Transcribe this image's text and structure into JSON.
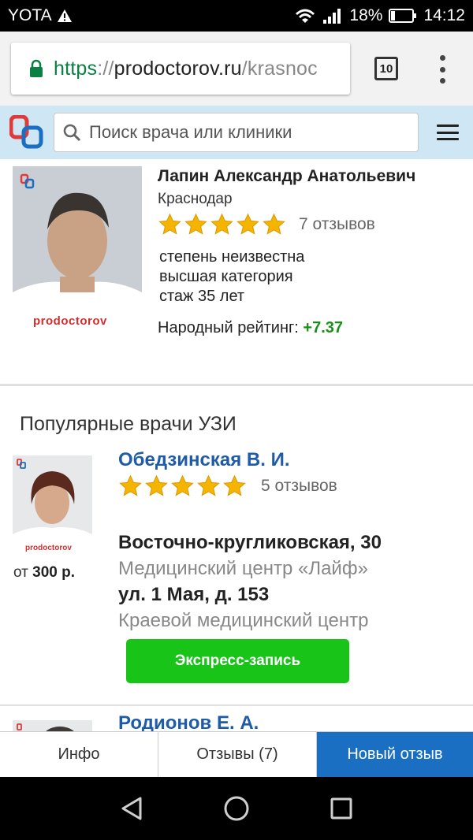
{
  "status_bar": {
    "carrier": "YOTA",
    "battery": "18%",
    "time": "14:12"
  },
  "browser": {
    "url_scheme": "https",
    "url_sep": "://",
    "url_host": "prodoctorov.ru",
    "url_path": "/krasnoc",
    "tab_count": "10"
  },
  "site_header": {
    "search_placeholder": "Поиск врача или клиники"
  },
  "doctor": {
    "name": "Лапин Александр Анатольевич",
    "city": "Краснодар",
    "stars": 5,
    "reviews": "7 отзывов",
    "degree": "степень неизвестна",
    "category": "высшая категория",
    "experience": "стаж 35 лет",
    "people_rating_label": "Народный рейтинг:",
    "people_rating_value": "+7.37",
    "photo_watermark": "prodoctorov"
  },
  "popular": {
    "title": "Популярные врачи УЗИ",
    "items": [
      {
        "name": "Обедзинская В. И.",
        "stars": 5,
        "reviews": "5 отзывов",
        "price_prefix": "от",
        "price": "300 р.",
        "addresses": [
          {
            "street": "Восточно-кругликовская, 30",
            "clinic": "Медицинский центр «Лайф»"
          },
          {
            "street": "ул. 1 Мая, д. 153",
            "clinic": "Краевой медицинский центр"
          }
        ],
        "button_label": "Экспресс-запись",
        "photo_watermark": "prodoctorov"
      },
      {
        "name": "Родионов Е. А."
      }
    ]
  },
  "bottom_tabs": [
    {
      "label": "Инфо",
      "active": false
    },
    {
      "label": "Отзывы (7)",
      "active": false
    },
    {
      "label": "Новый отзыв",
      "active": true
    }
  ],
  "colors": {
    "accent_blue": "#1b6fc2",
    "link_blue": "#1e5ba8",
    "express_green": "#18c418",
    "rating_green": "#1a8e1a",
    "star_gold": "#f5b400",
    "header_bg": "#cfe7f4"
  },
  "icons": [
    "warning-icon",
    "wifi-icon",
    "signal-icon",
    "battery-icon",
    "lock-icon",
    "search-icon",
    "menu-icon",
    "back-icon",
    "home-icon",
    "recents-icon"
  ]
}
